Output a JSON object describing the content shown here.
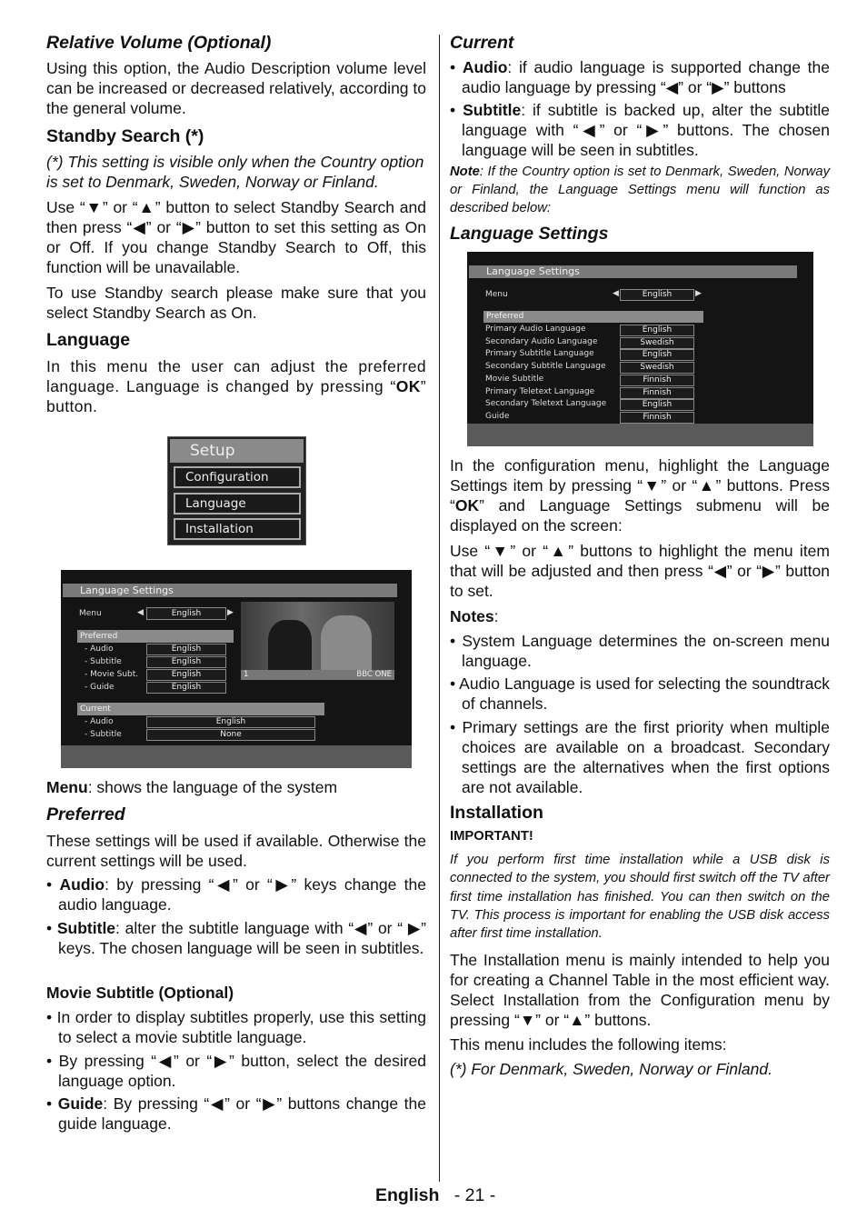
{
  "left": {
    "relvol_title": "Relative Volume (Optional)",
    "relvol_text": "Using this option, the Audio Description volume level can be increased or decreased relatively, according to the general volume.",
    "standby_title": "Standby Search (*)",
    "standby_note": "(*) This setting is visible only when the Country option is set to Denmark, Sweden, Norway or Finland.",
    "standby_text": "Use “▼” or “▲” button to select Standby Search and then press “◀” or “▶” button to set this setting as On or Off. If you change Standby Search to Off, this function will be unavailable.",
    "standby_text2": "To use Standby search please make sure that you select Standby Search as On.",
    "language_title": "Language",
    "language_text_a": "In this menu the user can adjust the preferred language. Language is changed by pressing “",
    "language_text_ok": "OK",
    "language_text_b": "” button.",
    "menu_bold": "Menu",
    "menu_text": ": shows the language of the system",
    "preferred_title": "Preferred",
    "preferred_text": "These settings will be used if available. Otherwise the current settings will be used.",
    "audio_bold": "Audio",
    "audio_text": ": by pressing “◀” or “▶” keys change the audio language.",
    "subtitle_bold": "Subtitle",
    "subtitle_text": ": alter the subtitle language with “◀” or “ ▶” keys. The chosen language will be seen in subtitles.",
    "movie_title": "Movie Subtitle (Optional)",
    "movie_b1": "• In order to display subtitles properly, use this setting to select a movie subtitle language.",
    "movie_b2": "• By pressing “◀” or “▶” button, select the desired language option.",
    "guide_bold": "Guide",
    "guide_text": ": By pressing  “◀” or “▶” buttons change the guide language."
  },
  "setup_menu": {
    "title": "Setup",
    "items": [
      "Configuration",
      "Language",
      "Installation"
    ]
  },
  "osd_left": {
    "title": "Language Settings",
    "menu_label": "Menu",
    "menu_value": "English",
    "preferred": "Preferred",
    "rows": [
      {
        "label": "- Audio",
        "value": "English"
      },
      {
        "label": "- Subtitle",
        "value": "English"
      },
      {
        "label": "- Movie Subt.",
        "value": "English"
      },
      {
        "label": "- Guide",
        "value": "English"
      }
    ],
    "current": "Current",
    "current_rows": [
      {
        "label": "- Audio",
        "value": "English"
      },
      {
        "label": "- Subtitle",
        "value": "None"
      }
    ],
    "channel_number": "1",
    "channel_name": "BBC ONE"
  },
  "right": {
    "current_title": "Current",
    "audio_bold": "Audio",
    "audio_text": ":  if audio language is supported change the audio language by pressing “◀” or “▶” buttons",
    "subtitle_bold": "Subtitle",
    "subtitle_text": ": if subtitle is backed up, alter the subtitle language with “◀” or “▶” buttons. The chosen language will be seen in subtitles.",
    "note_bold": "Note",
    "note_text": ": If the Country option is set to Denmark, Sweden, Norway or Finland, the Language Settings menu will function as described below:",
    "langset_title": "Language Settings",
    "p1_a": "In the configuration menu, highlight the Language Settings item by pressing “▼” or “▲” buttons. Press “",
    "p1_ok": "OK",
    "p1_b": "” and Language Settings submenu will be displayed on the screen:",
    "p2": "Use “▼” or “▲” buttons to highlight the menu item that will be adjusted and then press “◀” or “▶” button to set.",
    "notes_bold": "Notes",
    "notes_colon": ":",
    "n1": "• System Language determines the on-screen menu language.",
    "n2": "• Audio Language is used for selecting the soundtrack of channels.",
    "n3": "• Primary settings are the first priority when multiple choices are available on a broadcast. Secondary settings are the alternatives when the first options are not available.",
    "install_title": "Installation",
    "important": "IMPORTANT!",
    "important_text": "If you perform first time installation while a USB disk is connected to the system, you should first switch off the TV after first time installation has finished. You can then switch on the TV. This process is important for enabling the USB disk access after first time installation.",
    "install_p1": "The Installation menu is mainly intended to help you for creating a Channel Table in the most efficient way. Select Installation from the Configuration menu by pressing “▼” or “▲” buttons.",
    "install_p2": "This menu includes the following items:",
    "install_note": "(*) For Denmark, Sweden, Norway or Finland."
  },
  "osd_right": {
    "title": "Language Settings",
    "menu_label": "Menu",
    "menu_value": "English",
    "preferred": "Preferred",
    "rows": [
      {
        "label": "Primary Audio Language",
        "value": "English"
      },
      {
        "label": "Secondary Audio Language",
        "value": "Swedish"
      },
      {
        "label": "Primary Subtitle Language",
        "value": "English"
      },
      {
        "label": "Secondary Subtitle Language",
        "value": "Swedish"
      },
      {
        "label": "Movie Subtitle",
        "value": "Finnish"
      },
      {
        "label": "Primary Teletext Language",
        "value": "Finnish"
      },
      {
        "label": "Secondary Teletext Language",
        "value": "English"
      },
      {
        "label": "Guide",
        "value": "Finnish"
      }
    ]
  },
  "footer": {
    "language": "English",
    "page": "- 21 -"
  }
}
